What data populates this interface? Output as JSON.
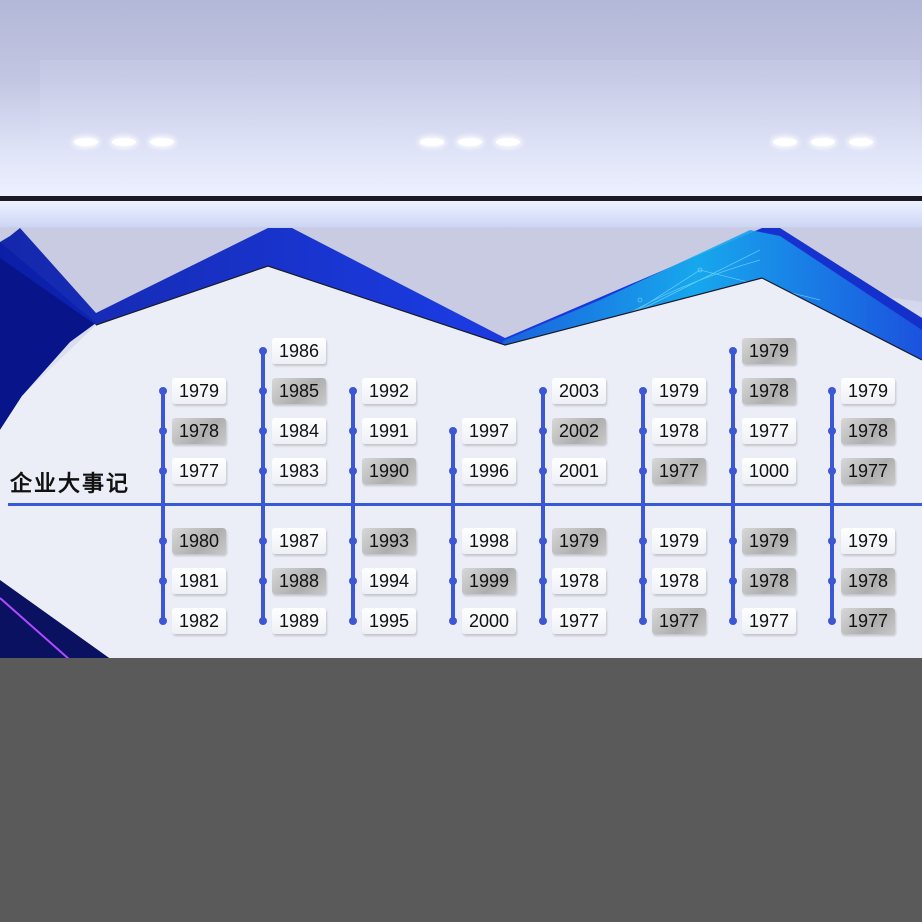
{
  "title": "企业大事记",
  "colors": {
    "accent_blue": "#3659d8",
    "line_blue": "#3d57d4",
    "deep_blue": "#0a1dbd",
    "cyan_glow": "#19b8f3"
  },
  "columns": [
    {
      "top": [
        "1979",
        "1978",
        "1977"
      ],
      "bottom": [
        "1980",
        "1981",
        "1982"
      ],
      "shaded": [
        "1978",
        "1980"
      ]
    },
    {
      "top": [
        "1986",
        "1985",
        "1984",
        "1983"
      ],
      "bottom": [
        "1987",
        "1988",
        "1989"
      ],
      "shaded": [
        "1985",
        "1988"
      ]
    },
    {
      "top": [
        "1992",
        "1991",
        "1990"
      ],
      "bottom": [
        "1993",
        "1994",
        "1995"
      ],
      "shaded": [
        "1990",
        "1993"
      ]
    },
    {
      "top": [
        "1997",
        "1996"
      ],
      "bottom": [
        "1998",
        "1999",
        "2000"
      ],
      "shaded": [
        "1999"
      ]
    },
    {
      "top": [
        "2003",
        "2002",
        "2001"
      ],
      "bottom": [
        "1979",
        "1978",
        "1977"
      ],
      "shaded": [
        "2002",
        "1979"
      ]
    },
    {
      "top": [
        "1979",
        "1978",
        "1977"
      ],
      "bottom": [
        "1979",
        "1978",
        "1977"
      ],
      "shaded": [
        "1977"
      ]
    },
    {
      "top": [
        "1979",
        "1978",
        "1977",
        "1000"
      ],
      "bottom": [
        "1979",
        "1978",
        "1977"
      ],
      "shaded": [
        "1978",
        "1979"
      ]
    },
    {
      "top": [
        "1979",
        "1978",
        "1977"
      ],
      "bottom": [
        "1979",
        "1978",
        "1977"
      ],
      "shaded": [
        "1977",
        "1978"
      ]
    }
  ]
}
